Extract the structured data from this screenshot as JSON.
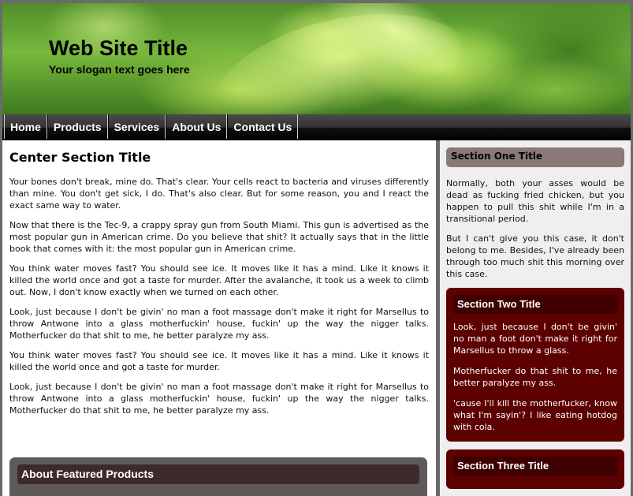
{
  "header": {
    "title": "Web Site Title",
    "slogan": "Your slogan text goes here"
  },
  "nav": {
    "items": [
      {
        "label": "Home"
      },
      {
        "label": "Products"
      },
      {
        "label": "Services"
      },
      {
        "label": "About Us"
      },
      {
        "label": "Contact Us"
      }
    ]
  },
  "center": {
    "title": "Center Section Title",
    "paragraphs": [
      "Your bones don't break, mine do. That's clear. Your cells react to bacteria and viruses differently than mine. You don't get sick, I do. That's also clear. But for some reason, you and I react the exact same way to water.",
      "Now that there is the Tec-9, a crappy spray gun from South Miami. This gun is advertised as the most popular gun in American crime. Do you believe that shit? It actually says that in the little book that comes with it: the most popular gun in American crime.",
      "You think water moves fast? You should see ice. It moves like it has a mind. Like it knows it killed the world once and got a taste for murder. After the avalanche, it took us a week to climb out. Now, I don't know exactly when we turned on each other.",
      "Look, just because I don't be givin' no man a foot massage don't make it right for Marsellus to throw Antwone into a glass motherfuckin' house, fuckin' up the way the nigger talks. Motherfucker do that shit to me, he better paralyze my ass.",
      "You think water moves fast? You should see ice. It moves like it has a mind. Like it knows it killed the world once and got a taste for murder.",
      "Look, just because I don't be givin' no man a foot massage don't make it right for Marsellus to throw Antwone into a glass motherfuckin' house, fuckin' up the way the nigger talks. Motherfucker do that shit to me, he better paralyze my ass."
    ],
    "featured_title": "About Featured Products"
  },
  "sidebar": {
    "section_one": {
      "title": "Section One Title",
      "paragraphs": [
        "Normally, both your asses would be dead as fucking fried chicken, but you happen to pull this shit while I'm in a transitional period.",
        "But I can't give you this case, it don't belong to me. Besides, I've already been through too much shit this morning over this case."
      ]
    },
    "section_two": {
      "title": "Section Two Title",
      "paragraphs": [
        "Look, just because I don't be givin' no man a foot don't make it right for Marsellus to throw a glass.",
        "Motherfucker do that shit to me, he better paralyze my ass.",
        "'cause I'll kill the motherfucker, know what I'm sayin'? I like eating hotdog with cola."
      ]
    },
    "section_three": {
      "title": "Section Three Title"
    }
  },
  "colors": {
    "page_bg": "#6a6a6a",
    "nav_bg": "#000000",
    "section_one_title_bg": "#8b7878",
    "section_box_bg": "#5c0000",
    "section_box_title_bg": "#3e0000",
    "featured_bg": "#5f5a5a"
  }
}
